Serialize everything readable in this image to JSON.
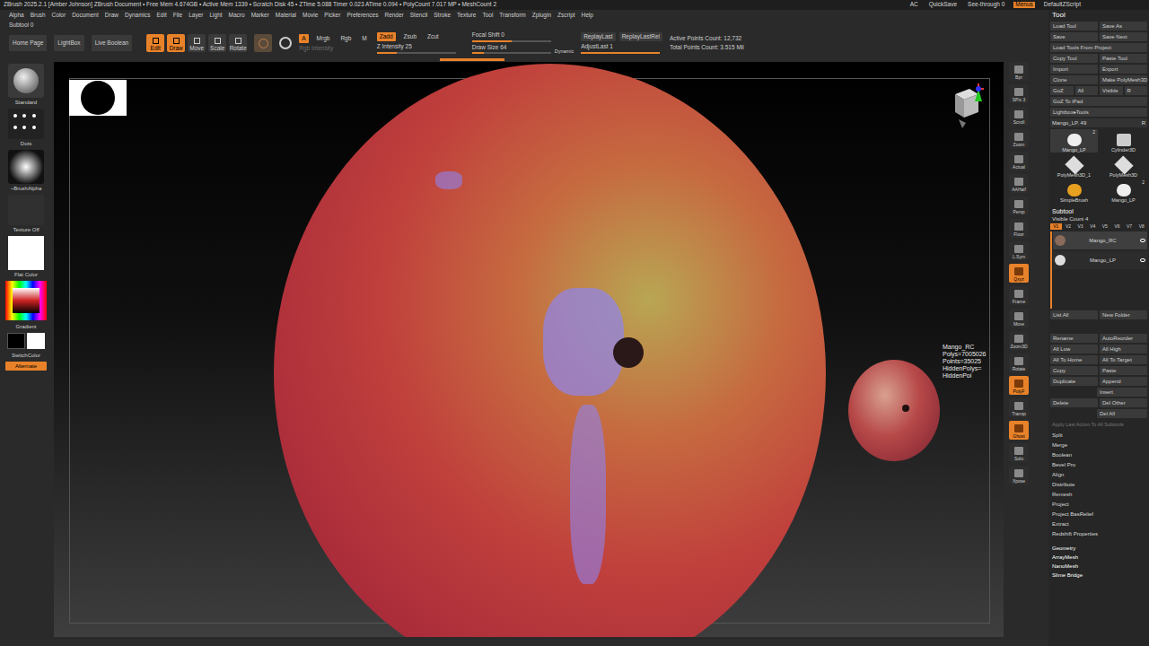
{
  "title_bar": {
    "info": "ZBrush 2025.2.1 [Amber Johnson]   ZBrush Document   • Free Mem 4.674GB • Active Mem 1339 • Scratch Disk 45 • ZTime 5.088 Timer 0.023 ATime 0.094 • PolyCount 7.017 MP • MeshCount 2",
    "right": [
      {
        "label": "AC",
        "selected": false
      },
      {
        "label": "QuickSave",
        "selected": false
      },
      {
        "label": "See-through  0",
        "selected": false
      },
      {
        "label": "Menus",
        "selected": true
      },
      {
        "label": "DefaultZScript",
        "selected": false
      }
    ]
  },
  "menus": [
    "Alpha",
    "Brush",
    "Color",
    "Document",
    "Draw",
    "Dynamics",
    "Edit",
    "File",
    "Layer",
    "Light",
    "Macro",
    "Marker",
    "Material",
    "Movie",
    "Picker",
    "Preferences",
    "Render",
    "Stencil",
    "Stroke",
    "Texture",
    "Tool",
    "Transform",
    "Zplugin",
    "Zscript",
    "Help"
  ],
  "subtool_status": "Subtool 0",
  "toolbar": {
    "nav": [
      "Home Page",
      "LightBox",
      "Live Boolean"
    ],
    "modes": [
      {
        "label": "Edit",
        "selected": true
      },
      {
        "label": "Draw",
        "selected": true
      },
      {
        "label": "Move",
        "selected": false
      },
      {
        "label": "Scale",
        "selected": false
      },
      {
        "label": "Rotate",
        "selected": false
      }
    ],
    "color_modes": [
      {
        "label": "A",
        "selected": true
      },
      {
        "label": "Mrgb",
        "selected": false
      },
      {
        "label": "Rgb",
        "selected": false
      },
      {
        "label": "M",
        "selected": false
      }
    ],
    "z_modes": [
      {
        "label": "Zadd",
        "selected": true
      },
      {
        "label": "Zsub",
        "selected": false
      },
      {
        "label": "Zcut",
        "selected": false
      }
    ],
    "rgb_intensity": "Rgb Intensity",
    "z_intensity": {
      "label": "Z Intensity 25",
      "level": 0.25
    },
    "focal_shift": {
      "label": "Focal Shift 0",
      "level": 0.5
    },
    "draw_size": {
      "label": "Draw Size 64",
      "level": 0.15
    },
    "dynamic": "Dynamic",
    "replay": [
      "ReplayLast",
      "ReplayLastRel"
    ],
    "adjust_last": {
      "label": "AdjustLast 1",
      "level": 1
    },
    "counts": [
      "Active Points Count: 12,732",
      "Total Points Count: 3.515 Mil"
    ]
  },
  "progress_bar": {
    "level": 1
  },
  "left_shelf": {
    "brushes": [
      "Standard",
      "Dots",
      "~BrushAlpha",
      "Texture Off"
    ],
    "material": "Flat Color",
    "gradient": "Gradient",
    "switch_color": "SwitchColor",
    "alternate": {
      "label": "Alternate",
      "selected": true
    }
  },
  "viewport": {
    "info": [
      "Mango_RC",
      "Polys=7005026",
      "Points=35025",
      "HiddenPolys=",
      "HiddenPoi"
    ]
  },
  "view_tools": [
    {
      "label": "Bpr",
      "selected": false
    },
    {
      "label": "SPix 3",
      "selected": false
    },
    {
      "label": "Scroll",
      "selected": false
    },
    {
      "label": "Zoom",
      "selected": false
    },
    {
      "label": "Actual",
      "selected": false
    },
    {
      "label": "AAHalf",
      "selected": false
    },
    {
      "label": "Persp",
      "selected": false
    },
    {
      "label": "Floor",
      "selected": false
    },
    {
      "label": "L.Sym",
      "selected": false
    },
    {
      "label": "Qxyz",
      "selected": true
    },
    {
      "label": "Frame",
      "selected": false
    },
    {
      "label": "Move",
      "selected": false
    },
    {
      "label": "Zoom3D",
      "selected": false
    },
    {
      "label": "Rotate",
      "selected": false
    },
    {
      "label": "PolyF",
      "selected": true
    },
    {
      "label": "Transp",
      "selected": false
    },
    {
      "label": "Ghost",
      "selected": true
    },
    {
      "label": "Solo",
      "selected": false
    },
    {
      "label": "Xpose",
      "selected": false
    }
  ],
  "tool_panel": {
    "title": "Tool",
    "actions": [
      [
        "Load Tool",
        "Save As"
      ],
      [
        "Save",
        "Save Next"
      ],
      [
        "Load Tools From Project"
      ],
      [
        "Copy Tool",
        "Paste Tool"
      ],
      [
        "Import",
        "Export"
      ],
      [
        "Clone",
        "Make PolyMesh3D"
      ],
      [
        "GoZ",
        "All",
        "Visible",
        "R"
      ],
      [
        "GoZ To iPad"
      ],
      [
        "Lightbox▸Tools"
      ]
    ],
    "current_tool": {
      "label": "Mango_LP. 49",
      "r": "R"
    },
    "thumbnails": [
      {
        "label": "Mango_LP",
        "count": "2",
        "selected": true
      },
      {
        "label": "Cylinder3D",
        "count": "",
        "selected": false
      },
      {
        "label": "PolyMesh3D_1",
        "count": "",
        "selected": false
      },
      {
        "label": "PolyMesh3D",
        "count": "",
        "selected": false
      },
      {
        "label": "SimpleBrush",
        "count": "",
        "selected": false
      },
      {
        "label": "Mango_LP",
        "count": "2",
        "selected": false
      }
    ],
    "subtool_header": "Subtool",
    "visible_count": "Visible Count 4",
    "visibility_sets": [
      {
        "label": "V1",
        "selected": true
      },
      {
        "label": "V2",
        "selected": false
      },
      {
        "label": "V3",
        "selected": false
      },
      {
        "label": "V4",
        "selected": false
      },
      {
        "label": "V5",
        "selected": false
      },
      {
        "label": "V6",
        "selected": false
      },
      {
        "label": "V7",
        "selected": false
      },
      {
        "label": "V8",
        "selected": false
      }
    ],
    "subtools": [
      {
        "name": "Mango_RC",
        "selected": true
      },
      {
        "name": "Mango_LP",
        "selected": false
      }
    ],
    "list_row": [
      "List All",
      "New Folder"
    ],
    "subtool_actions": [
      [
        "Rename",
        "AutoReorder"
      ],
      [
        "All Low",
        "All High"
      ],
      [
        "All To Home",
        "All To Target"
      ],
      [
        "Copy",
        "Paste"
      ],
      [
        "Duplicate",
        "Append"
      ],
      [
        "",
        "Insert"
      ],
      [
        "Delete",
        "Del Other"
      ],
      [
        "",
        "Del All"
      ]
    ],
    "apply_all": "Apply Last Action To All Subtools",
    "sections": [
      "Split",
      "Merge",
      "Boolean",
      "Bevel Pro",
      "Align",
      "Distribute",
      "Remesh",
      "Project",
      "Project BasRelief",
      "Extract",
      "Redshift Properties"
    ],
    "palettes": [
      "Geometry",
      "ArrayMesh",
      "NanoMesh",
      "Slime Bridge"
    ]
  }
}
